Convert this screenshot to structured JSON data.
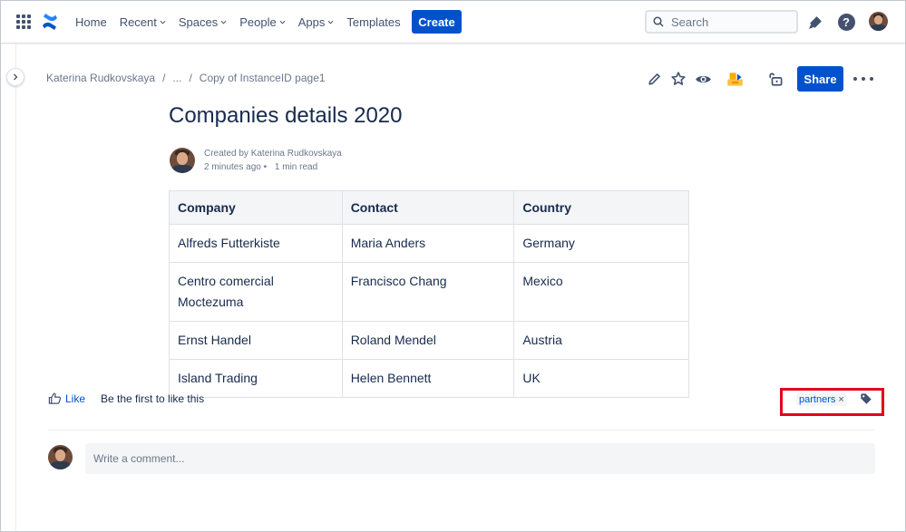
{
  "nav": {
    "items": [
      {
        "label": "Home",
        "dropdown": false
      },
      {
        "label": "Recent",
        "dropdown": true
      },
      {
        "label": "Spaces",
        "dropdown": true
      },
      {
        "label": "People",
        "dropdown": true
      },
      {
        "label": "Apps",
        "dropdown": true
      },
      {
        "label": "Templates",
        "dropdown": false
      }
    ],
    "create_label": "Create",
    "search_placeholder": "Search",
    "icons": [
      "apps-grid-icon",
      "confluence-logo-icon",
      "notifications-icon",
      "help-icon",
      "user-avatar"
    ]
  },
  "breadcrumb": {
    "items": [
      "Katerina Rudkovskaya",
      "...",
      "Copy of InstanceID page1"
    ],
    "separator": "/"
  },
  "toolbar": {
    "share_label": "Share",
    "icons": [
      "edit-icon",
      "star-icon",
      "watch-icon",
      "app-icon",
      "restrictions-icon",
      "more-icon"
    ]
  },
  "page": {
    "title": "Companies details 2020",
    "byline_created": "Created by Katerina Rudkovskaya",
    "byline_time": "2 minutes ago",
    "byline_sep": "•",
    "byline_read": "1 min read"
  },
  "table": {
    "headers": [
      "Company",
      "Contact",
      "Country"
    ],
    "rows": [
      [
        "Alfreds Futterkiste",
        "Maria Anders",
        "Germany"
      ],
      [
        "Centro comercial Moctezuma",
        "Francisco Chang",
        "Mexico"
      ],
      [
        "Ernst Handel",
        "Roland Mendel",
        "Austria"
      ],
      [
        "Island Trading",
        "Helen Bennett",
        "UK"
      ]
    ]
  },
  "footer": {
    "like_label": "Like",
    "like_text": "Be the first to like this",
    "label_chip": "partners",
    "label_remove": "×",
    "comment_placeholder": "Write a comment..."
  },
  "colors": {
    "brand_blue": "#0052cc",
    "highlight_red": "#e3001b",
    "text": "#172b4d",
    "subtle_text": "#6b778c"
  }
}
